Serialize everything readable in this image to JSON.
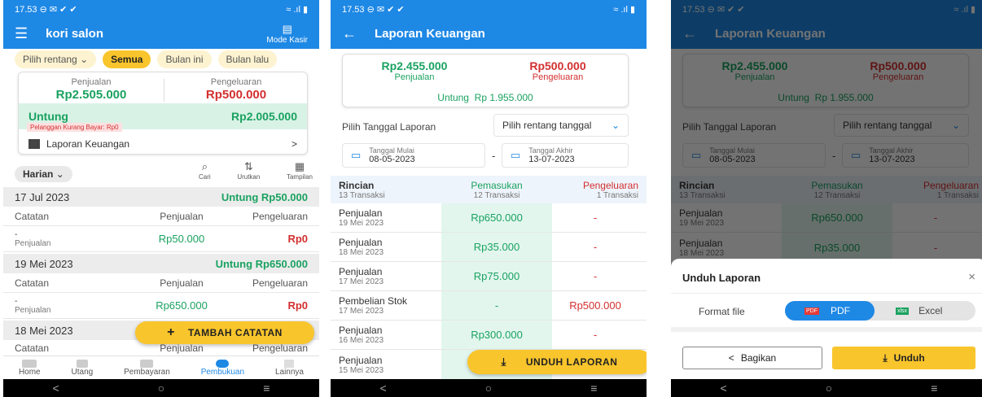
{
  "status": {
    "time": "17.53",
    "icons_left": "⊖ ✉ ✔ ✔",
    "icons_right": "≈ .ıl ▮"
  },
  "screen1": {
    "app_title": "kori salon",
    "mode_kasir": "Mode Kasir",
    "filters": [
      {
        "label": "Pilih rentang",
        "active": false,
        "dropdown": true
      },
      {
        "label": "Semua",
        "active": true,
        "dropdown": false
      },
      {
        "label": "Bulan ini",
        "active": false,
        "dropdown": false
      },
      {
        "label": "Bulan lalu",
        "active": false,
        "dropdown": false
      }
    ],
    "summary": {
      "penjualan_label": "Penjualan",
      "penjualan_value": "Rp2.505.000",
      "pengeluaran_label": "Pengeluaran",
      "pengeluaran_value": "Rp500.000",
      "untung_label": "Untung",
      "untung_value": "Rp2.005.000",
      "debt_note": "Pelanggan Kurang Bayar: Rp0",
      "report_link": "Laporan Keuangan",
      "report_arrow": ">"
    },
    "period_select": "Harian",
    "tools": [
      {
        "icon": "search-icon",
        "label": "Cari"
      },
      {
        "icon": "sort-icon",
        "label": "Urutkan"
      },
      {
        "icon": "view-icon",
        "label": "Tampilan"
      }
    ],
    "columns": {
      "catatan": "Catatan",
      "penjualan": "Penjualan",
      "pengeluaran": "Pengeluaran"
    },
    "groups": [
      {
        "date": "17 Jul 2023",
        "untung": "Untung Rp50.000",
        "dash": "-",
        "type": "Penjualan",
        "penjualan": "Rp50.000",
        "pengeluaran": "Rp0"
      },
      {
        "date": "19 Mei 2023",
        "untung": "Untung Rp650.000",
        "dash": "-",
        "type": "Penjualan",
        "penjualan": "Rp650.000",
        "pengeluaran": "Rp0"
      },
      {
        "date": "18 Mei 2023"
      }
    ],
    "fab_label": "TAMBAH CATATAN",
    "bottom_nav": [
      "Home",
      "Utang",
      "Pembayaran",
      "Pembukuan",
      "Lainnya"
    ],
    "active_nav": "Pembukuan"
  },
  "screen2": {
    "title": "Laporan Keuangan",
    "penjualan_value": "Rp2.455.000",
    "penjualan_label": "Penjualan",
    "pengeluaran_value": "Rp500.000",
    "pengeluaran_label": "Pengeluaran",
    "untung_label": "Untung",
    "untung_value": "Rp 1.955.000",
    "date_label": "Pilih Tanggal Laporan",
    "range_select": "Pilih rentang tanggal",
    "start_label": "Tanggal Mulai",
    "start_value": "08-05-2023",
    "end_label": "Tanggal Akhir",
    "end_value": "13-07-2023",
    "range_dash": "-",
    "header": {
      "rincian": "Rincian",
      "rincian_sub": "13 Transaksi",
      "pemasukan": "Pemasukan",
      "pemasukan_sub": "12 Transaksi",
      "pengeluaran": "Pengeluaran",
      "pengeluaran_sub": "1 Transaksi"
    },
    "rows": [
      {
        "name": "Penjualan",
        "date": "19 Mei 2023",
        "in": "Rp650.000",
        "out": "-"
      },
      {
        "name": "Penjualan",
        "date": "18 Mei 2023",
        "in": "Rp35.000",
        "out": "-"
      },
      {
        "name": "Penjualan",
        "date": "17 Mei 2023",
        "in": "Rp75.000",
        "out": "-"
      },
      {
        "name": "Pembelian Stok",
        "date": "17 Mei 2023",
        "in": "-",
        "out": "Rp500.000"
      },
      {
        "name": "Penjualan",
        "date": "16 Mei 2023",
        "in": "Rp300.000",
        "out": "-"
      },
      {
        "name": "Penjualan",
        "date": "15 Mei 2023",
        "in": "",
        "out": ""
      }
    ],
    "fab_label": "UNDUH LAPORAN"
  },
  "screen3": {
    "sheet_title": "Unduh Laporan",
    "format_label": "Format file",
    "pdf_badge": "PDF",
    "pdf_label": "PDF",
    "excel_badge": "xlsx",
    "excel_label": "Excel",
    "share_label": "Bagikan",
    "download_label": "Unduh"
  },
  "colors": {
    "primary": "#1e88e5",
    "accent": "#f9c52c",
    "green": "#1aa260",
    "red": "#d32f2f"
  }
}
